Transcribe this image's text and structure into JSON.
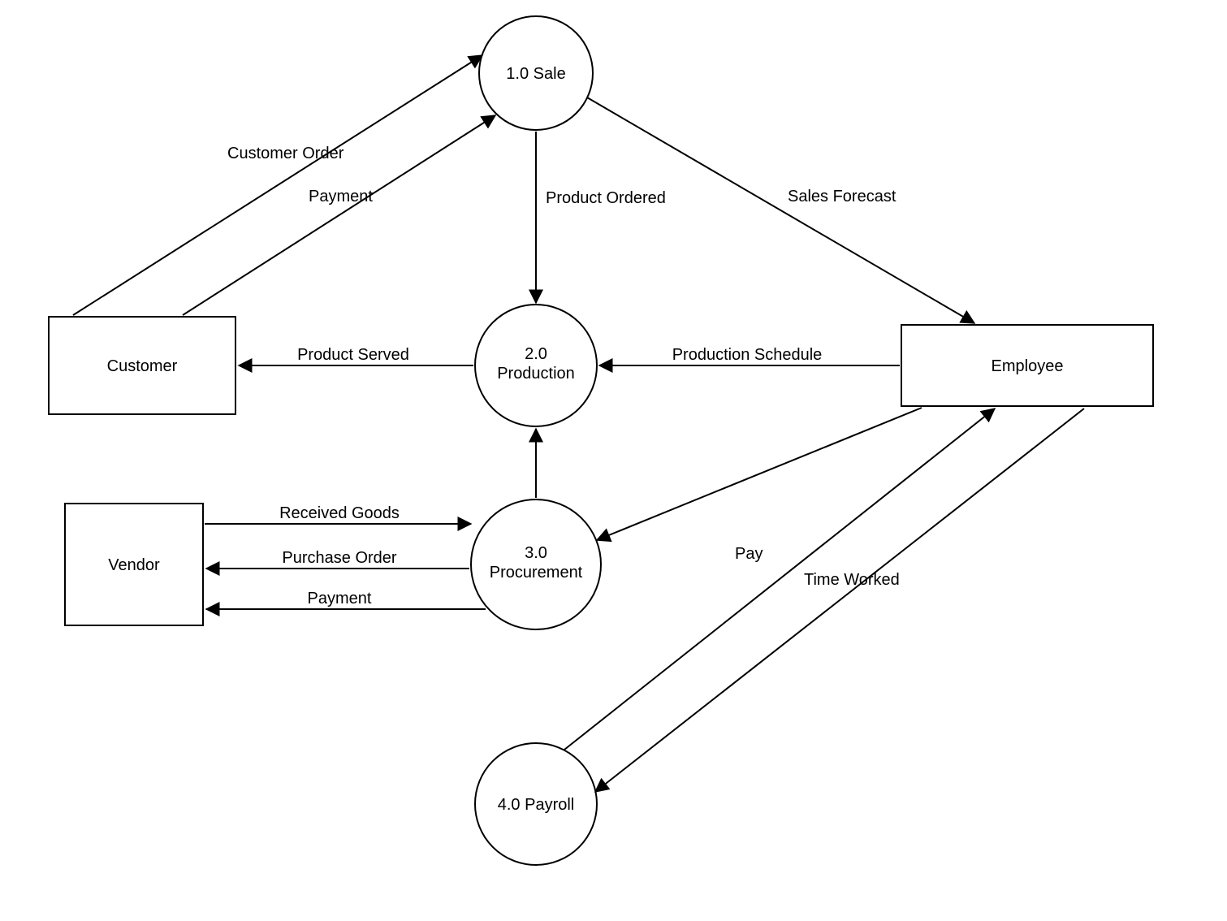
{
  "entities": {
    "customer": "Customer",
    "vendor": "Vendor",
    "employee": "Employee"
  },
  "processes": {
    "sale": {
      "num": "1.0",
      "name": "Sale"
    },
    "production": {
      "num": "2.0",
      "name": "Production"
    },
    "procurement": {
      "num": "3.0",
      "name": "Procurement"
    },
    "payroll": {
      "num": "4.0",
      "name": "Payroll"
    }
  },
  "flows": {
    "customer_order": "Customer Order",
    "payment_cust": "Payment",
    "product_ordered": "Product Ordered",
    "sales_forecast": "Sales Forecast",
    "product_served": "Product Served",
    "production_schedule": "Production Schedule",
    "received_goods": "Received Goods",
    "purchase_order": "Purchase Order",
    "payment_vendor": "Payment",
    "pay": "Pay",
    "time_worked": "Time Worked"
  }
}
